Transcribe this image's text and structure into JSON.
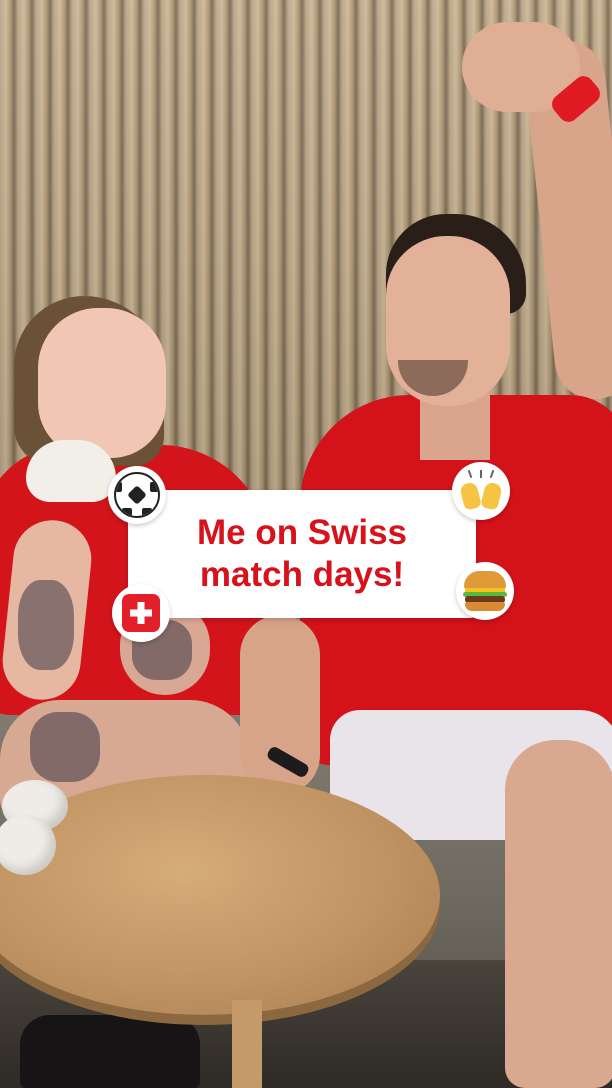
{
  "caption": {
    "line1": "Me on Swiss",
    "line2": "match days!"
  },
  "stickers": [
    {
      "name": "soccer-ball-icon"
    },
    {
      "name": "raising-hands-icon"
    },
    {
      "name": "swiss-flag-icon"
    },
    {
      "name": "burger-icon"
    }
  ],
  "colors": {
    "caption_text": "#d8121b",
    "jersey_red": "#d4121a",
    "card_background": "#ffffff"
  }
}
